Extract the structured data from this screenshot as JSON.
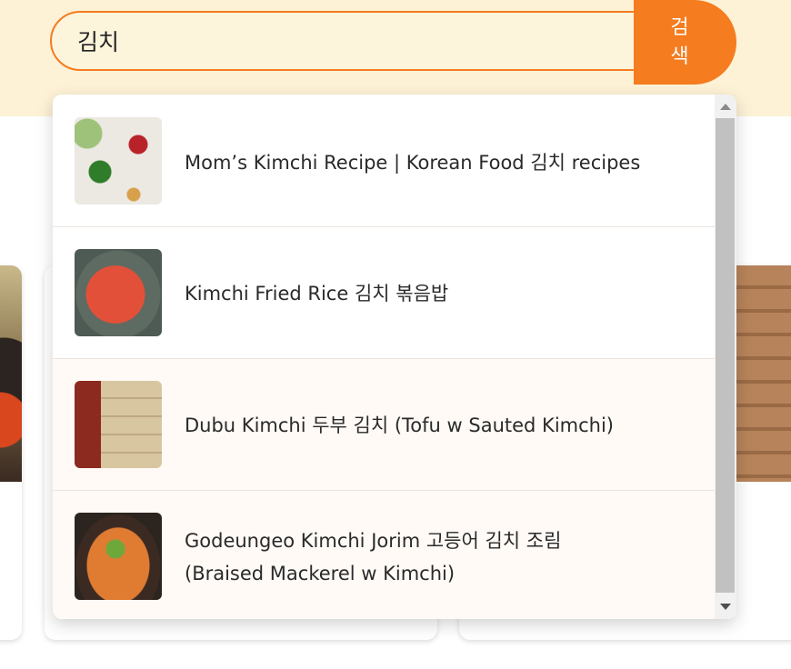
{
  "search": {
    "query": "김치",
    "button_label_line1": "검",
    "button_label_line2": "색"
  },
  "results": [
    {
      "title": "Mom’s Kimchi Recipe | Korean Food 김치 recipes",
      "thumbnail": "kimchi-ingredients-photo"
    },
    {
      "title": "Kimchi Fried Rice 김치 볶음밥",
      "thumbnail": "kimchi-fried-rice-photo"
    },
    {
      "title": "Dubu Kimchi 두부 김치 (Tofu w Sauted Kimchi)",
      "thumbnail": "tofu-kimchi-photo"
    },
    {
      "title_line1": "Godeungeo Kimchi Jorim 고등어 김치 조림",
      "title_line2": "(Braised Mackerel w Kimchi)",
      "thumbnail": "braised-mackerel-photo"
    }
  ],
  "colors": {
    "accent": "#f57c1f",
    "header_background": "#fdf1d6",
    "scrollbar_thumb": "#c1c1c1"
  }
}
